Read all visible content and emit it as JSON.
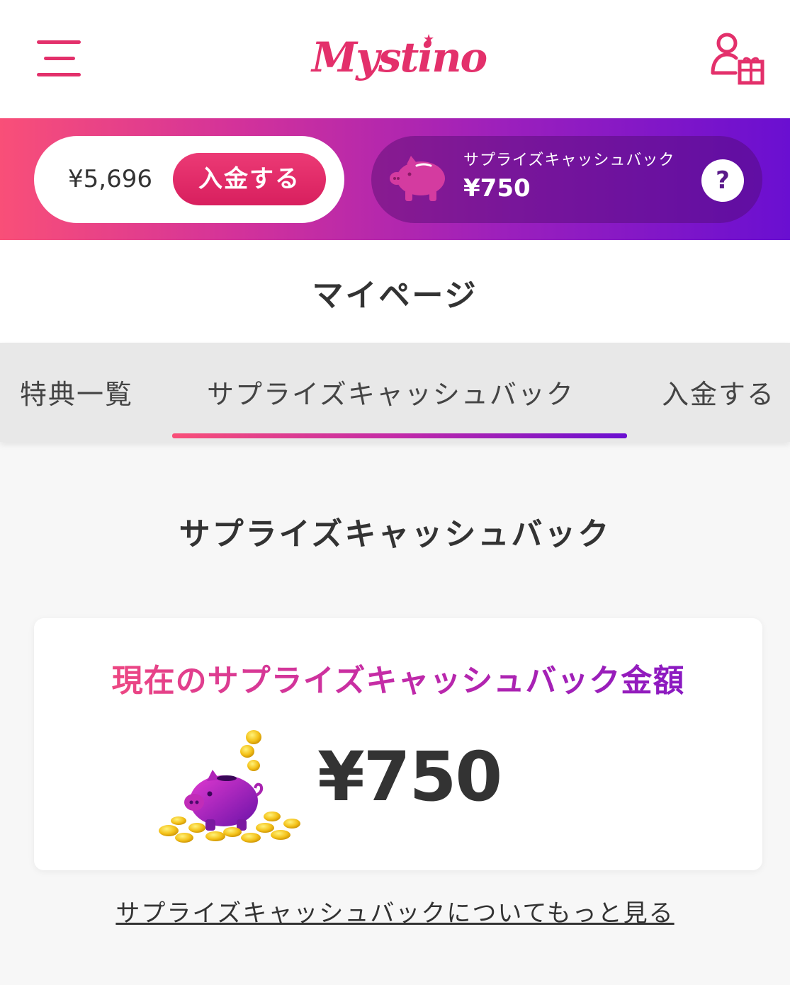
{
  "header": {
    "logo_text": "Mystino",
    "menu_icon": "hamburger-menu-icon",
    "account_icon": "user-gift-icon",
    "brand_color": "#e3306b"
  },
  "banner": {
    "balance": "¥5,696",
    "deposit_label": "入金する",
    "cashback_label": "サプライズキャッシュバック",
    "cashback_amount": "¥750",
    "help_label": "?",
    "pig_icon": "piggy-bank-icon"
  },
  "page": {
    "title": "マイページ"
  },
  "tabs": [
    {
      "label": "特典一覧",
      "active": false
    },
    {
      "label": "サプライズキャッシュバック",
      "active": true
    },
    {
      "label": "入金する",
      "active": false
    }
  ],
  "section": {
    "title": "サプライズキャッシュバック"
  },
  "card": {
    "title": "現在のサプライズキャッシュバック金額",
    "amount": "¥750",
    "illustration": "piggy-bank-with-coins"
  },
  "link": {
    "more": "サプライズキャッシュバックについてもっと見る"
  }
}
